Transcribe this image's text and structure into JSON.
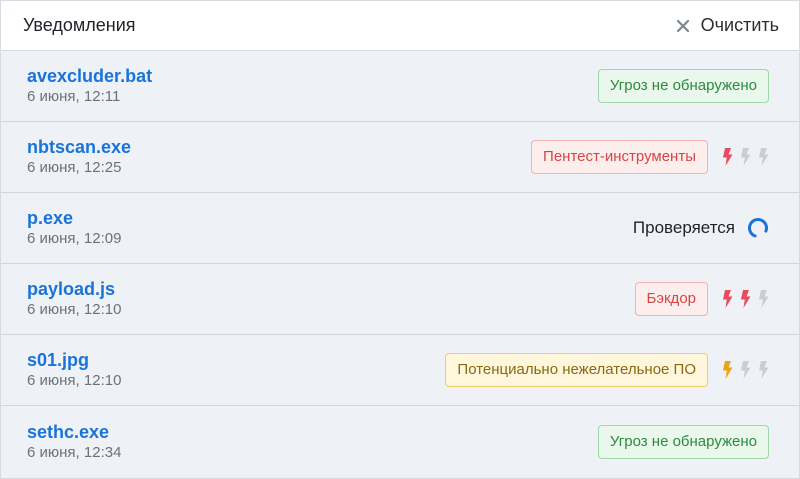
{
  "header": {
    "title": "Уведомления",
    "clear_label": "Очистить",
    "clear_icon": "close-icon"
  },
  "colors": {
    "link": "#1a73d9",
    "bolt_red": "#e84a5f",
    "bolt_yellow": "#e8a317",
    "bolt_gray": "#c9ced4",
    "spinner": "#1a73d9"
  },
  "notifications": [
    {
      "file": "avexcluder.bat",
      "date": "6 июня, 12:11",
      "status": "Угроз не обнаружено",
      "status_type": "clean",
      "severity": null
    },
    {
      "file": "nbtscan.exe",
      "date": "6 июня, 12:25",
      "status": "Пентест-инструменты",
      "status_type": "danger",
      "severity": {
        "level": 1,
        "max": 3,
        "color": "red"
      }
    },
    {
      "file": "p.exe",
      "date": "6 июня, 12:09",
      "status": "Проверяется",
      "status_type": "checking",
      "severity": null
    },
    {
      "file": "payload.js",
      "date": "6 июня, 12:10",
      "status": "Бэкдор",
      "status_type": "danger",
      "severity": {
        "level": 2,
        "max": 3,
        "color": "red"
      }
    },
    {
      "file": "s01.jpg",
      "date": "6 июня, 12:10",
      "status": "Потенциально нежелательное ПО",
      "status_type": "warning",
      "severity": {
        "level": 1,
        "max": 3,
        "color": "yellow"
      }
    },
    {
      "file": "sethc.exe",
      "date": "6 июня, 12:34",
      "status": "Угроз не обнаружено",
      "status_type": "clean",
      "severity": null
    }
  ]
}
